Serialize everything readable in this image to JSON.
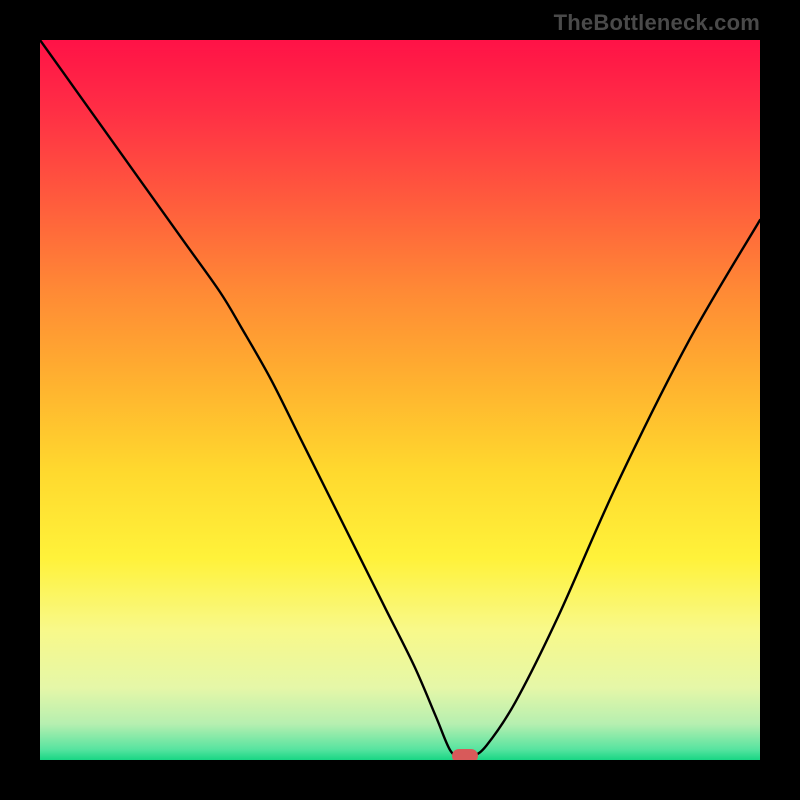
{
  "watermark": "TheBottleneck.com",
  "chart_data": {
    "type": "line",
    "title": "",
    "xlabel": "",
    "ylabel": "",
    "xlim": [
      0,
      100
    ],
    "ylim": [
      0,
      100
    ],
    "x": [
      0,
      5,
      10,
      15,
      20,
      25,
      28,
      32,
      36,
      40,
      44,
      48,
      52,
      55,
      57,
      58.5,
      60,
      62,
      66,
      72,
      80,
      90,
      100
    ],
    "values": [
      100,
      93,
      86,
      79,
      72,
      65,
      60,
      53,
      45,
      37,
      29,
      21,
      13,
      6,
      1.3,
      0.5,
      0.5,
      2,
      8,
      20,
      38,
      58,
      75
    ],
    "minimum_marker": {
      "x": 59,
      "y": 0.5,
      "color": "#d85a5a"
    },
    "gradient_stops": [
      {
        "pos": 0.0,
        "color": "#ff1247"
      },
      {
        "pos": 0.1,
        "color": "#ff2f45"
      },
      {
        "pos": 0.22,
        "color": "#ff5a3d"
      },
      {
        "pos": 0.35,
        "color": "#ff8a35"
      },
      {
        "pos": 0.48,
        "color": "#ffb32f"
      },
      {
        "pos": 0.6,
        "color": "#ffd92e"
      },
      {
        "pos": 0.72,
        "color": "#fff23a"
      },
      {
        "pos": 0.82,
        "color": "#f8f98a"
      },
      {
        "pos": 0.9,
        "color": "#e5f7a8"
      },
      {
        "pos": 0.95,
        "color": "#b6efb0"
      },
      {
        "pos": 0.985,
        "color": "#58e4a0"
      },
      {
        "pos": 1.0,
        "color": "#18d684"
      }
    ],
    "curve_stroke": "#000000",
    "curve_width": 2.4
  }
}
